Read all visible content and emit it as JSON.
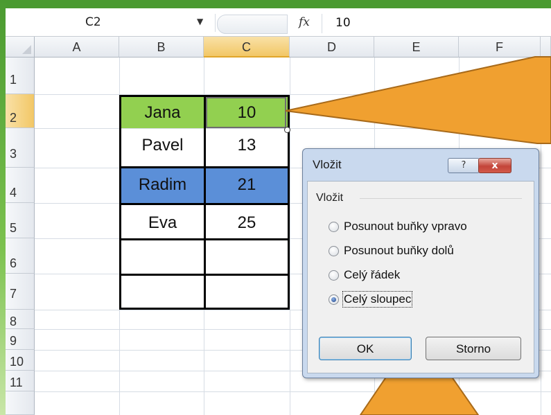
{
  "formula_bar": {
    "name_box": "C2",
    "fx_label": "fx",
    "content": "10"
  },
  "columns": [
    "A",
    "B",
    "C",
    "D",
    "E",
    "F"
  ],
  "rows": [
    "1",
    "2",
    "3",
    "4",
    "5",
    "6",
    "7",
    "8",
    "9",
    "10",
    "11"
  ],
  "table": [
    {
      "name": "Jana",
      "value": "10"
    },
    {
      "name": "Pavel",
      "value": "13"
    },
    {
      "name": "Radim",
      "value": "21"
    },
    {
      "name": "Eva",
      "value": "25"
    }
  ],
  "colors": {
    "jana_fill": "#92d050",
    "radim_fill": "#5b8fd8",
    "callout": "#f0a030"
  },
  "dialog": {
    "title": "Vložit",
    "group_label": "Vložit",
    "options": [
      "Posunout buňky vpravo",
      "Posunout buňky dolů",
      "Celý řádek",
      "Celý sloupec"
    ],
    "selected_option": "Celý sloupec",
    "ok_label": "OK",
    "cancel_label": "Storno",
    "help_label": "?",
    "close_label": "x"
  }
}
